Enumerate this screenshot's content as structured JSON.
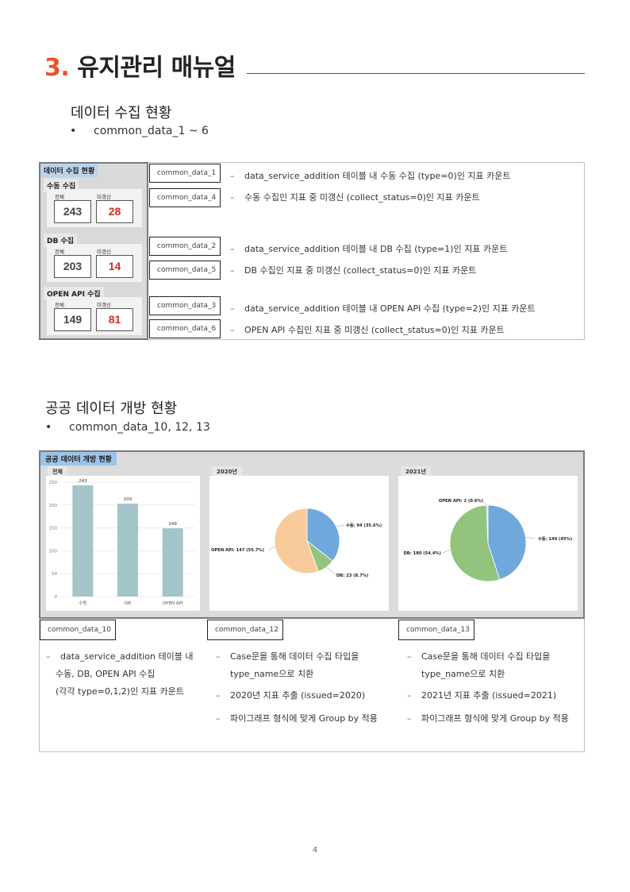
{
  "heading": {
    "number": "3.",
    "title": "유지관리 매뉴얼"
  },
  "section1": {
    "title": "데이터 수집 현황",
    "bullet": "common_data_1 ~ 6",
    "widget": {
      "title": "데이터 수집 현황",
      "groups": [
        {
          "label": "수동 수집",
          "total_label": "전체",
          "missing_label": "미갱신",
          "total": "243",
          "missing": "28"
        },
        {
          "label": "DB 수집",
          "total_label": "전체",
          "missing_label": "미갱신",
          "total": "203",
          "missing": "14"
        },
        {
          "label": "OPEN API 수집",
          "total_label": "전체",
          "missing_label": "미갱신",
          "total": "149",
          "missing": "81"
        }
      ]
    },
    "items": [
      {
        "code": "common_data_1",
        "desc": "data_service_addition 테이블 내 수동 수집 (type=0)인 지표 카운트"
      },
      {
        "code": "common_data_4",
        "desc": "수동 수집인 지표 중 미갱신 (collect_status=0)인 지표 카운트"
      },
      {
        "code": "common_data_2",
        "desc": "data_service_addition 테이블 내 DB 수집 (type=1)인 지표 카운트"
      },
      {
        "code": "common_data_5",
        "desc": "DB 수집인 지표 중 미갱신 (collect_status=0)인 지표 카운트"
      },
      {
        "code": "common_data_3",
        "desc": "data_service_addition 테이블 내 OPEN API 수집 (type=2)인 지표 카운트"
      },
      {
        "code": "common_data_6",
        "desc": "OPEN API 수집인 지표 중 미갱신 (collect_status=0)인 지표 카운트"
      }
    ]
  },
  "section2": {
    "title": "공공 데이터 개방 현황",
    "bullet": "common_data_10, 12, 13",
    "screenshot_title": "공공 데이터 개방 현황",
    "panels": [
      {
        "tab": "전체"
      },
      {
        "tab": "2020년"
      },
      {
        "tab": "2021년"
      }
    ],
    "codes": [
      "common_data_10",
      "common_data_12",
      "common_data_13"
    ],
    "col1": [
      "data_service_addition 테이블 내",
      "수동, DB, OPEN API 수집",
      "(각각 type=0,1,2)인 지표 카운트"
    ],
    "col2": [
      "Case문을 통해 데이터 수집 타입을",
      "type_name으로 치환",
      "2020년 지표 추출 (issued=2020)",
      "파이그래프 형식에 맞게 Group by 적용"
    ],
    "col3": [
      "Case문을 통해 데이터 수집 타입을",
      "type_name으로 치환",
      "2021년 지표 추출 (issued=2021)",
      "파이그래프 형식에 맞게 Group by 적용"
    ]
  },
  "chart_data": [
    {
      "type": "bar",
      "categories": [
        "수동",
        "DB",
        "OPEN API"
      ],
      "values": [
        243,
        203,
        149
      ],
      "ylim": [
        0,
        250
      ],
      "yticks": [
        0,
        50,
        100,
        150,
        200,
        250
      ],
      "color": "#a3c4c9",
      "grid": true
    },
    {
      "type": "pie",
      "slices": [
        {
          "label": "수동: 94 (35.6%)",
          "value": 94,
          "color": "#6fa8dc"
        },
        {
          "label": "DB: 23 (8.7%)",
          "value": 23,
          "color": "#93c47d"
        },
        {
          "label": "OPEN API: 147 (55.7%)",
          "value": 147,
          "color": "#f9cb9c"
        }
      ]
    },
    {
      "type": "pie",
      "slices": [
        {
          "label": "수동: 149 (45%)",
          "value": 149,
          "color": "#6fa8dc"
        },
        {
          "label": "DB: 180 (54.4%)",
          "value": 180,
          "color": "#93c47d"
        },
        {
          "label": "OPEN API: 2 (0.6%)",
          "value": 2,
          "color": "#f9cb9c"
        }
      ]
    }
  ],
  "page_number": "4"
}
